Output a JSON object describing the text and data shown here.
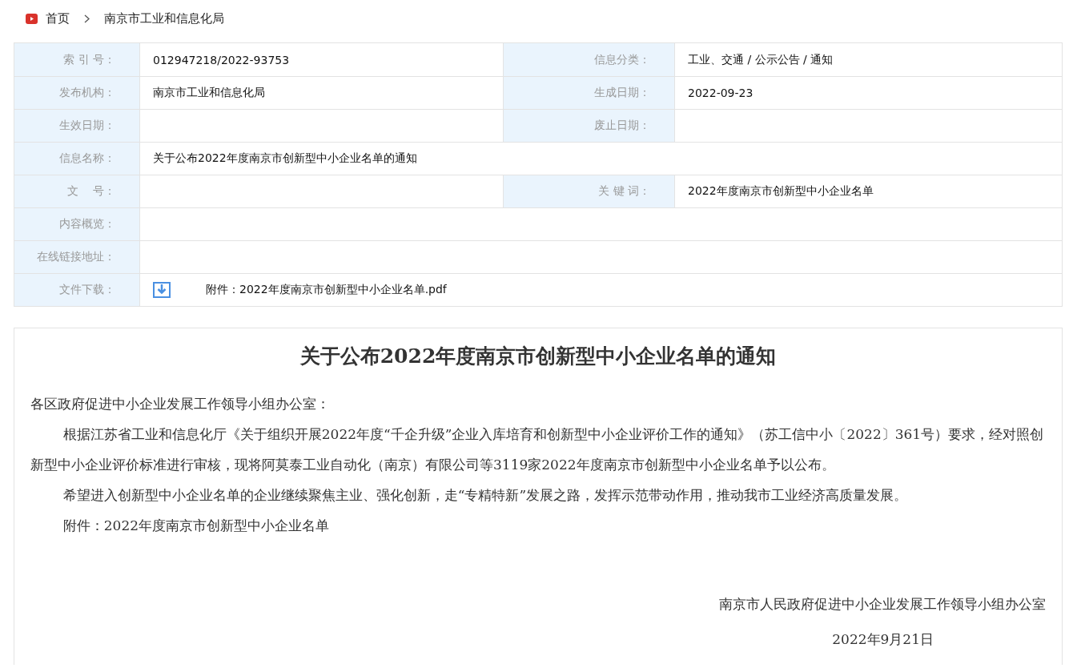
{
  "breadcrumb": [
    {
      "label": "首页"
    },
    {
      "label": "南京市工业和信息化局"
    }
  ],
  "meta_rows": [
    {
      "kind": "pair",
      "cells": [
        {
          "label": "索 引 号：",
          "value": "012947218/2022-93753"
        },
        {
          "label": "信息分类：",
          "value": "工业、交通 / 公示公告 / 通知"
        }
      ]
    },
    {
      "kind": "pair",
      "cells": [
        {
          "label": "发布机构：",
          "value": "南京市工业和信息化局"
        },
        {
          "label": "生成日期：",
          "value": "2022-09-23"
        }
      ]
    },
    {
      "kind": "pair",
      "cells": [
        {
          "label": "生效日期："
        },
        {
          "label": "废止日期："
        }
      ]
    },
    {
      "kind": "pair",
      "cells": [
        {
          "label": "信息名称：",
          "value": "关于公布2022年度南京市创新型中小企业名单的通知"
        }
      ]
    },
    {
      "kind": "pair",
      "cells": [
        {
          "label": "文    号："
        },
        {
          "label": "关 键 词：",
          "value": "2022年度南京市创新型中小企业名单"
        }
      ]
    },
    {
      "kind": "pair",
      "cells": [
        {
          "label": "内容概览："
        }
      ]
    },
    {
      "kind": "pair",
      "cells": [
        {
          "label": "在线链接地址："
        }
      ]
    },
    {
      "kind": "file",
      "cells": [
        {
          "label": "文件下载：",
          "value": "附件：2022年度南京市创新型中小企业名单.pdf"
        }
      ]
    }
  ],
  "article": {
    "title": "关于公布2022年度南京市创新型中小企业名单的通知",
    "salutation": "各区政府促进中小企业发展工作领导小组办公室：",
    "paragraphs": [
      "根据江苏省工业和信息化厅《关于组织开展2022年度“千企升级”企业入库培育和创新型中小企业评价工作的通知》（苏工信中小〔2022〕361号）要求，经对照创新型中小企业评价标准进行审核，现将阿莫泰工业自动化（南京）有限公司等3119家2022年度南京市创新型中小企业名单予以公布。",
      "希望进入创新型中小企业名单的企业继续聚焦主业、强化创新，走“专精特新”发展之路，发挥示范带动作用，推动我市工业经济高质量发展。",
      "附件：2022年度南京市创新型中小企业名单"
    ],
    "signature": "南京市人民政府促进中小企业发展工作领导小组办公室",
    "date": "2022年9月21日"
  }
}
